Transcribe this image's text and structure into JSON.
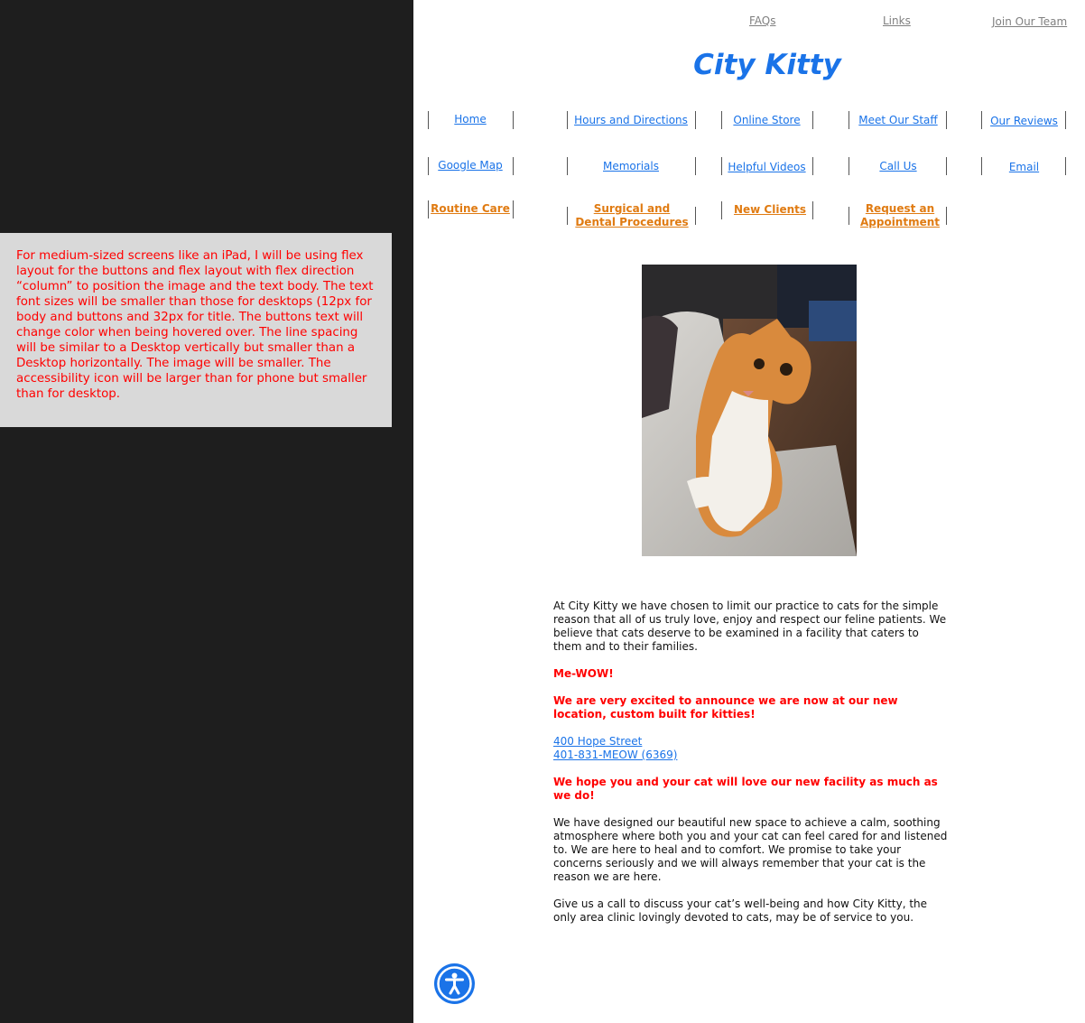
{
  "note": {
    "text": "For medium-sized screens like an iPad, I will be using flex layout for the buttons and flex layout with flex direction “column” to position the image and the text body. The text font sizes will be smaller than those for desktops (12px for body and buttons and 32px for title. The buttons text will change color when being hovered over. The line spacing will be similar to a Desktop vertically but smaller than a Desktop horizontally. The image will be smaller. The accessibility icon will be larger than for phone but smaller than for desktop."
  },
  "top_links": {
    "faqs": "FAQs",
    "links": "Links",
    "join": "Join Our Team"
  },
  "site_title": "City Kitty",
  "nav": {
    "row1": [
      "Home",
      "Hours and Directions",
      "Online Store",
      "Meet Our Staff",
      "Our Reviews"
    ],
    "row2": [
      "Google Map",
      "Memorials",
      "Helpful Videos",
      "Call Us",
      "Email"
    ],
    "row3": [
      "Routine Care",
      "Surgical and Dental Procedures",
      "New Clients",
      "Request an Appointment"
    ]
  },
  "colors": {
    "link_blue": "#1a73e8",
    "button_orange": "#e07b12",
    "highlight_red": "#ff0000"
  },
  "image": {
    "alt": "orange and white cat"
  },
  "body": {
    "intro": "At City Kitty we have chosen to limit our practice to cats for the simple reason that all of us truly love, enjoy and respect our feline patients. We believe that cats deserve to be examined in a facility that caters to them and to their families.",
    "mewow": "Me-WOW!",
    "announce": "We are very excited to announce we are now at our new location, custom built for kitties!",
    "address": "400 Hope Street",
    "phone": "401-831-MEOW (6369)",
    "hope": "We hope you and your cat will love our new facility as much as we do!",
    "designed": "We have designed our beautiful new space to achieve a calm, soothing atmosphere where both you and your cat can feel cared for and listened to. We are here to heal and to comfort. We promise to take your concerns seriously and we will always remember that your cat is the reason we are here.",
    "call": "Give us a call to discuss your cat’s well-being and how City Kitty, the only area clinic lovingly devoted to cats, may be of service to you."
  },
  "accessibility_icon": "accessibility-icon"
}
